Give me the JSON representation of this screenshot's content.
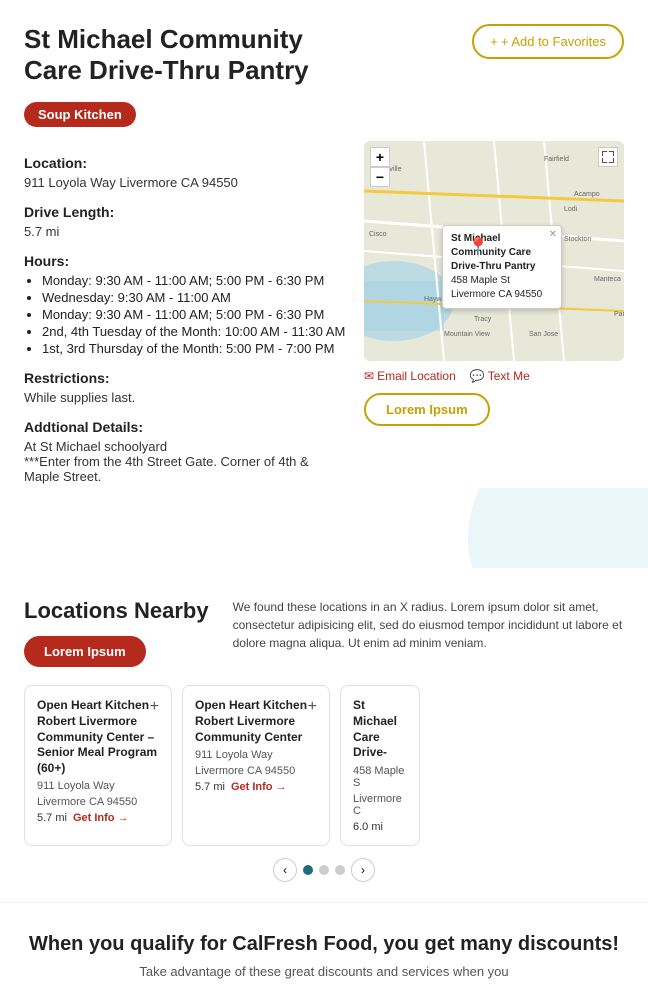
{
  "header": {
    "title": "St Michael Community Care Drive-Thru Pantry",
    "add_favorites_label": "+ Add to Favorites"
  },
  "tag": "Soup Kitchen",
  "location": {
    "label": "Location:",
    "value": "911 Loyola Way Livermore CA 94550"
  },
  "drive_length": {
    "label": "Drive Length:",
    "value": "5.7 mi"
  },
  "hours": {
    "label": "Hours:",
    "items": [
      "Monday: 9:30 AM - 11:00 AM; 5:00 PM - 6:30 PM",
      "Wednesday: 9:30 AM - 11:00 AM",
      "Monday: 9:30 AM - 11:00 AM; 5:00 PM - 6:30 PM",
      "2nd, 4th Tuesday of the Month: 10:00 AM - 11:30 AM",
      "1st, 3rd Thursday of the Month: 5:00 PM - 7:00 PM"
    ]
  },
  "restrictions": {
    "label": "Restrictions:",
    "value": "While supplies last."
  },
  "additional_details": {
    "label": "Addtional Details:",
    "value": "At St Michael schoolyard\n***Enter from the 4th Street Gate. Corner of 4th & Maple Street."
  },
  "map": {
    "popup_title": "St Michael Community Care Drive-Thru Pantry",
    "popup_address": "458 Maple St",
    "popup_city": "Livermore CA 94550"
  },
  "map_actions": {
    "email_label": "Email Location",
    "text_label": "Text Me"
  },
  "lorem_btn_label": "Lorem Ipsum",
  "locations_nearby": {
    "title": "Locations Nearby",
    "description": "We found these locations in an X radius. Lorem ipsum dolor sit amet, consectetur adipisicing elit, sed do eiusmod tempor incididunt ut labore et dolore magna aliqua. Ut enim ad minim veniam.",
    "lorem_btn": "Lorem Ipsum",
    "cards": [
      {
        "title": "Open Heart Kitchen Robert Livermore Community Center – Senior Meal Program (60+)",
        "address": "911 Loyola Way",
        "city": "Livermore CA 94550",
        "distance": "5.7 mi",
        "get_info": "Get Info →"
      },
      {
        "title": "Open Heart Kitchen Robert Livermore Community Center",
        "address": "911 Loyola Way",
        "city": "Livermore CA 94550",
        "distance": "5.7 mi",
        "get_info": "Get Info →"
      },
      {
        "title": "St Michael Care Drive-",
        "address": "458 Maple S",
        "city": "Livermore C",
        "distance": "6.0 mi",
        "get_info": ""
      }
    ]
  },
  "calfresh": {
    "title": "When you qualify for CalFresh Food, you get many discounts!",
    "description": "Take advantage of these great discounts and services when you"
  }
}
